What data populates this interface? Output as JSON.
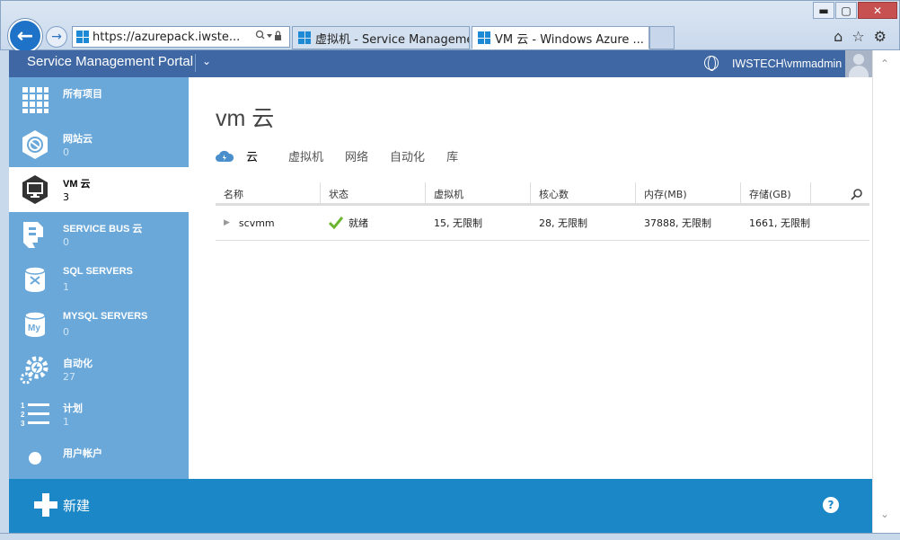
{
  "browser": {
    "url": "https://azurepack.iwste...",
    "tabs": [
      {
        "title": "虚拟机 - Service Management"
      },
      {
        "title": "VM 云 - Windows Azure ...",
        "close": "✕"
      }
    ],
    "window_controls": {
      "minimize": "▬",
      "maximize": "▢",
      "close": "✕"
    }
  },
  "portal": {
    "brand": "Service Management Portal",
    "user": "IWSTECH\\vmmadmin"
  },
  "sidebar": {
    "items": [
      {
        "label": "所有项目",
        "count": "",
        "icon": "grid-icon"
      },
      {
        "label": "网站云",
        "count": "0",
        "icon": "website-cloud-icon"
      },
      {
        "label": "VM 云",
        "count": "3",
        "icon": "vm-cloud-icon"
      },
      {
        "label": "SERVICE BUS 云",
        "count": "0",
        "icon": "service-bus-icon"
      },
      {
        "label": "SQL SERVERS",
        "count": "1",
        "icon": "sql-server-icon"
      },
      {
        "label": "MYSQL SERVERS",
        "count": "0",
        "icon": "mysql-server-icon",
        "icon_text": "My"
      },
      {
        "label": "自动化",
        "count": "27",
        "icon": "automation-icon"
      },
      {
        "label": "计划",
        "count": "1",
        "icon": "plans-icon",
        "icon_digits": [
          "1",
          "2",
          "3"
        ]
      },
      {
        "label": "用户帐户",
        "count": "",
        "icon": "user-accounts-icon"
      }
    ]
  },
  "main": {
    "title": "vm 云",
    "tabs": [
      "云",
      "虚拟机",
      "网络",
      "自动化",
      "库"
    ],
    "columns": [
      "名称",
      "状态",
      "虚拟机",
      "核心数",
      "内存(MB)",
      "存储(GB)"
    ],
    "rows": [
      {
        "name": "scvmm",
        "status": "就绪",
        "vms": "15, 无限制",
        "cores": "28, 无限制",
        "memory": "37888, 无限制",
        "storage": "1661, 无限制"
      }
    ]
  },
  "footer": {
    "new_label": "新建",
    "help": "?"
  },
  "colors": {
    "topbar": "#3e67a3",
    "sidebar": "#6aa8da",
    "bottom": "#1b87c7",
    "status_ok": "#6bb531"
  }
}
